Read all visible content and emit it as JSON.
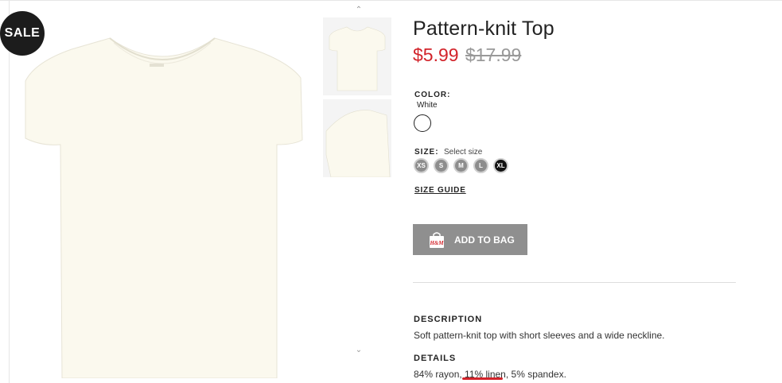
{
  "badge": {
    "label": "SALE"
  },
  "product": {
    "title": "Pattern-knit Top",
    "price_sale": "$5.99",
    "price_original": "$17.99"
  },
  "color": {
    "label": "COLOR:",
    "value": "White",
    "swatch": "#ffffff"
  },
  "size": {
    "label": "SIZE:",
    "prompt": "Select size",
    "options": [
      "XS",
      "S",
      "M",
      "L",
      "XL"
    ],
    "selected": "XL",
    "guide_label": "SIZE GUIDE"
  },
  "cart": {
    "add_label": "ADD TO BAG",
    "brand_mark": "H&M"
  },
  "description": {
    "label": "DESCRIPTION",
    "text": "Soft pattern-knit top with short sleeves and a wide neckline."
  },
  "details": {
    "label": "DETAILS",
    "text": "84% rayon, 11% linen, 5% spandex."
  },
  "colors": {
    "sale_red": "#d2232a",
    "button_gray": "#8f8f8f",
    "badge_black": "#1c1c1c"
  },
  "icons": {
    "thumb_up": "chevron-up-icon",
    "thumb_down": "chevron-down-icon",
    "bag": "shopping-bag-icon"
  }
}
